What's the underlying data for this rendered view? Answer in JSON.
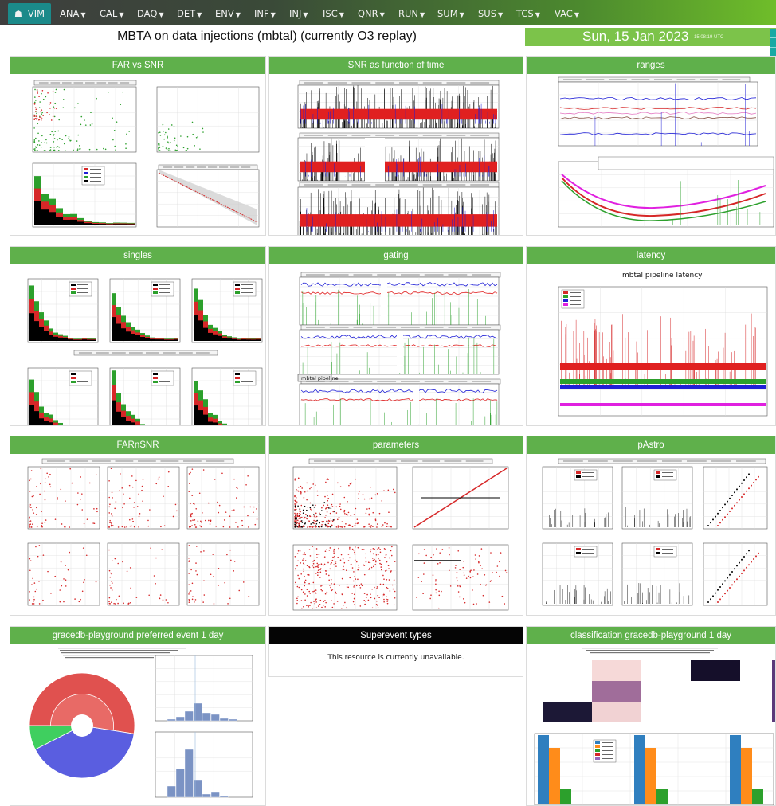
{
  "nav": {
    "items": [
      {
        "label": "VIM",
        "active": true
      },
      {
        "label": "ANA"
      },
      {
        "label": "CAL"
      },
      {
        "label": "DAQ"
      },
      {
        "label": "DET"
      },
      {
        "label": "ENV"
      },
      {
        "label": "INF"
      },
      {
        "label": "INJ"
      },
      {
        "label": "ISC"
      },
      {
        "label": "QNR"
      },
      {
        "label": "RUN"
      },
      {
        "label": "SUM"
      },
      {
        "label": "SUS"
      },
      {
        "label": "TCS"
      },
      {
        "label": "VAC"
      }
    ]
  },
  "header": {
    "title": "MBTA on data injections (mbtal) (currently O3 replay)",
    "date": "Sun, 15 Jan 2023",
    "time": "15:08:19 UTC"
  },
  "panels": [
    {
      "title": "FAR vs SNR",
      "plot": "far-vs-snr"
    },
    {
      "title": "SNR as function of time",
      "plot": "snr-time"
    },
    {
      "title": "ranges",
      "plot": "ranges"
    },
    {
      "title": "singles",
      "plot": "singles"
    },
    {
      "title": "gating",
      "plot": "gating"
    },
    {
      "title": "latency",
      "plot": "latency"
    },
    {
      "title": "FARnSNR",
      "plot": "farnsnr"
    },
    {
      "title": "parameters",
      "plot": "parameters"
    },
    {
      "title": "pAstro",
      "plot": "pastro"
    },
    {
      "title": "gracedb-playground preferred event 1 day",
      "plot": "gracedb-preferred"
    },
    {
      "title": "Superevent types",
      "message": "This resource is currently unavailable."
    },
    {
      "title": "classification gracedb-playground 1 day",
      "plot": "classification"
    }
  ],
  "plots": {
    "latency_title": "mbtal pipeline latency",
    "gating_label": "mbtal pipeline"
  },
  "colors": {
    "panel_header": "#5fb04b",
    "nav_active": "#1b8a8a",
    "date_box": "#7cc34a"
  }
}
